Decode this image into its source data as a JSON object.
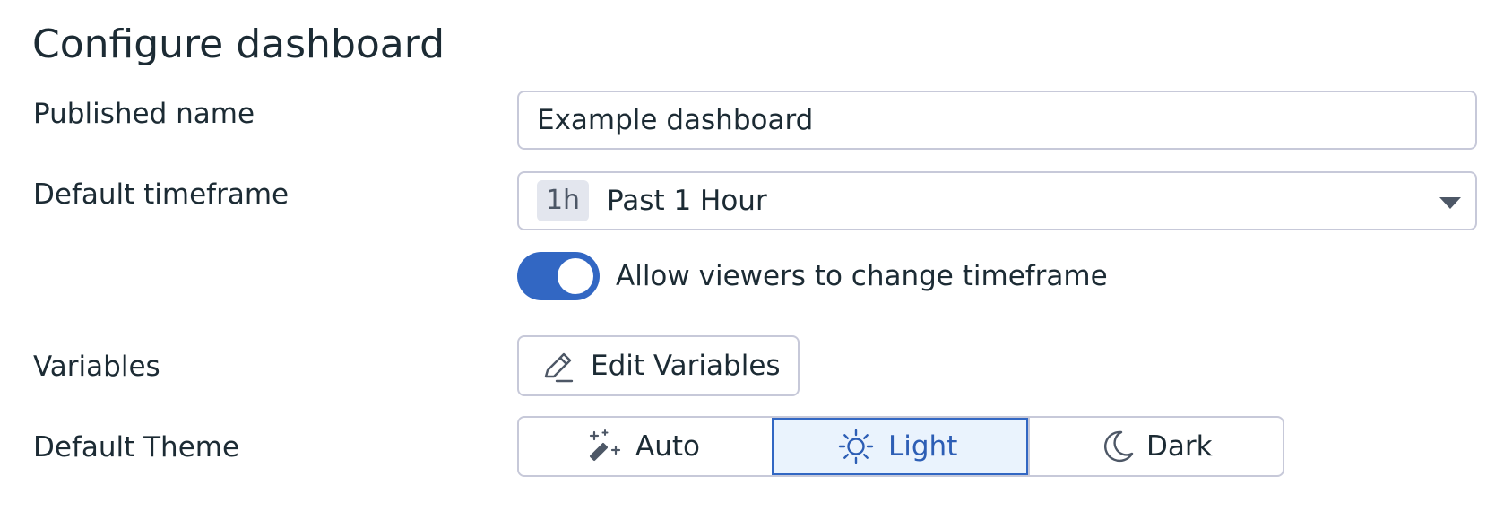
{
  "dialog": {
    "title": "Configure dashboard"
  },
  "fields": {
    "published_name": {
      "label": "Published name",
      "value": "Example dashboard"
    },
    "default_timeframe": {
      "label": "Default timeframe",
      "badge": "1h",
      "value": "Past 1 Hour",
      "caret_icon": "chevron-down-icon"
    },
    "allow_change": {
      "label": "Allow viewers to change timeframe",
      "enabled": true
    },
    "variables": {
      "label": "Variables",
      "button_label": "Edit Variables",
      "button_icon": "pencil-icon"
    },
    "default_theme": {
      "label": "Default Theme",
      "options": [
        {
          "label": "Auto",
          "icon": "magic-wand-icon",
          "selected": false
        },
        {
          "label": "Light",
          "icon": "sun-icon",
          "selected": true
        },
        {
          "label": "Dark",
          "icon": "moon-icon",
          "selected": false
        }
      ]
    }
  },
  "colors": {
    "accent": "#3267c3",
    "selected_background": "#eaf3fd",
    "text": "#1c2b34",
    "border": "#c7c9d9"
  }
}
